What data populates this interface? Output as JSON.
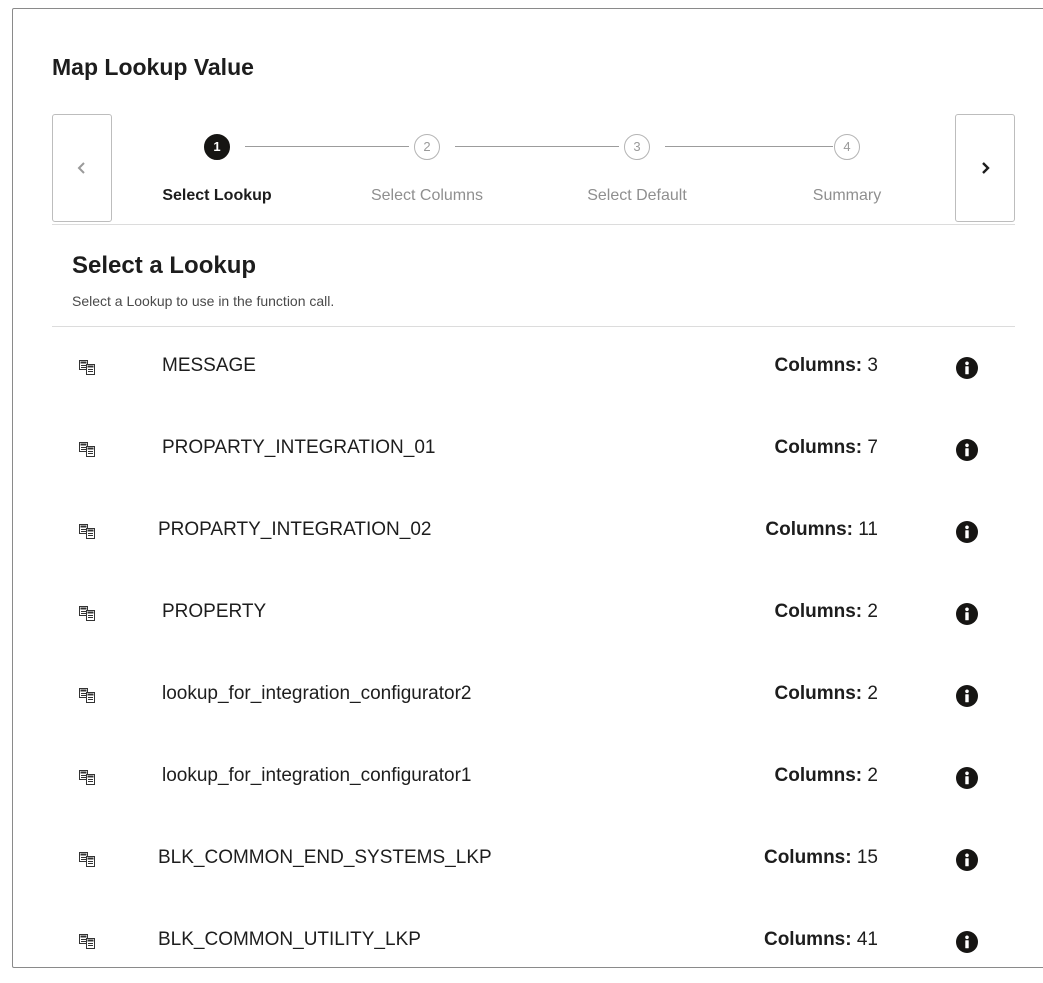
{
  "dialog": {
    "title": "Map Lookup Value"
  },
  "train": {
    "steps": [
      {
        "number": "1",
        "label": "Select Lookup",
        "state": "active"
      },
      {
        "number": "2",
        "label": "Select Columns",
        "state": "inactive"
      },
      {
        "number": "3",
        "label": "Select Default",
        "state": "inactive"
      },
      {
        "number": "4",
        "label": "Summary",
        "state": "inactive"
      }
    ],
    "prev_icon": "chevron-left-icon",
    "next_icon": "chevron-right-icon"
  },
  "section": {
    "title": "Select a Lookup",
    "subtitle": "Select a Lookup to use in the function call."
  },
  "lookups": {
    "columns_label": "Columns:",
    "row_icon": "lookup-table-icon",
    "info_icon": "info-icon",
    "items": [
      {
        "name": "MESSAGE",
        "columns": "3"
      },
      {
        "name": "PROPARTY_INTEGRATION_01",
        "columns": "7"
      },
      {
        "name": "PROPARTY_INTEGRATION_02",
        "columns": "11"
      },
      {
        "name": "PROPERTY",
        "columns": "2"
      },
      {
        "name": "lookup_for_integration_configurator2",
        "columns": "2"
      },
      {
        "name": "lookup_for_integration_configurator1",
        "columns": "2"
      },
      {
        "name": "BLK_COMMON_END_SYSTEMS_LKP",
        "columns": "15"
      },
      {
        "name": "BLK_COMMON_UTILITY_LKP",
        "columns": "41"
      }
    ]
  },
  "colors": {
    "text": "#1d1d1d",
    "active_step": "#161513",
    "inactive_step": "#9a9a9a",
    "divider": "#dcdcdc",
    "border": "#8a8a8a"
  }
}
